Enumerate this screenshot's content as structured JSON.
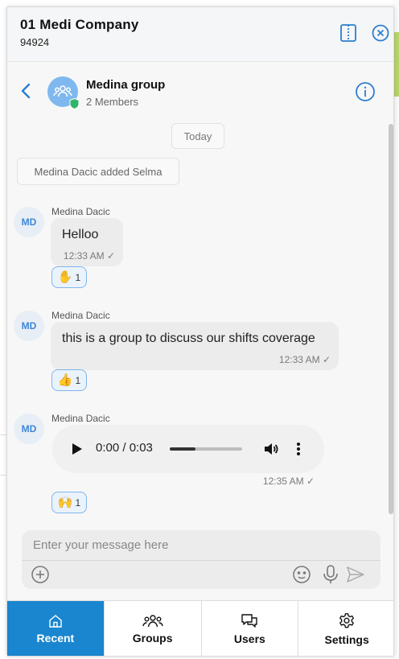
{
  "header": {
    "company_name": "01 Medi Company",
    "company_id": "94924"
  },
  "group": {
    "name": "Medina group",
    "members": "2 Members"
  },
  "chat": {
    "date_separator": "Today",
    "system_message": "Medina Dacic added Selma",
    "messages": [
      {
        "avatar": "MD",
        "sender": "Medina Dacic",
        "text": "Helloo",
        "time": "12:33 AM",
        "reaction_emoji": "✋",
        "reaction_count": "1"
      },
      {
        "avatar": "MD",
        "sender": "Medina Dacic",
        "text": "this is a group to discuss our shifts coverage",
        "time": "12:33 AM",
        "reaction_emoji": "👍",
        "reaction_count": "1"
      },
      {
        "avatar": "MD",
        "sender": "Medina Dacic",
        "audio_time": "0:00 / 0:03",
        "audio_progress": 0.35,
        "time": "12:35 AM",
        "reaction_emoji": "🙌",
        "reaction_count": "1"
      }
    ]
  },
  "composer": {
    "placeholder": "Enter your message here"
  },
  "nav": {
    "items": [
      {
        "label": "Recent",
        "icon": "home-icon",
        "active": true
      },
      {
        "label": "Groups",
        "icon": "groups-icon",
        "active": false
      },
      {
        "label": "Users",
        "icon": "chat-bubbles-icon",
        "active": false
      },
      {
        "label": "Settings",
        "icon": "gear-icon",
        "active": false
      }
    ]
  },
  "colors": {
    "accent": "#1a86cf",
    "bubble": "#ececec",
    "avatar_group": "#7fb8ef",
    "shield": "#2fb56b"
  }
}
